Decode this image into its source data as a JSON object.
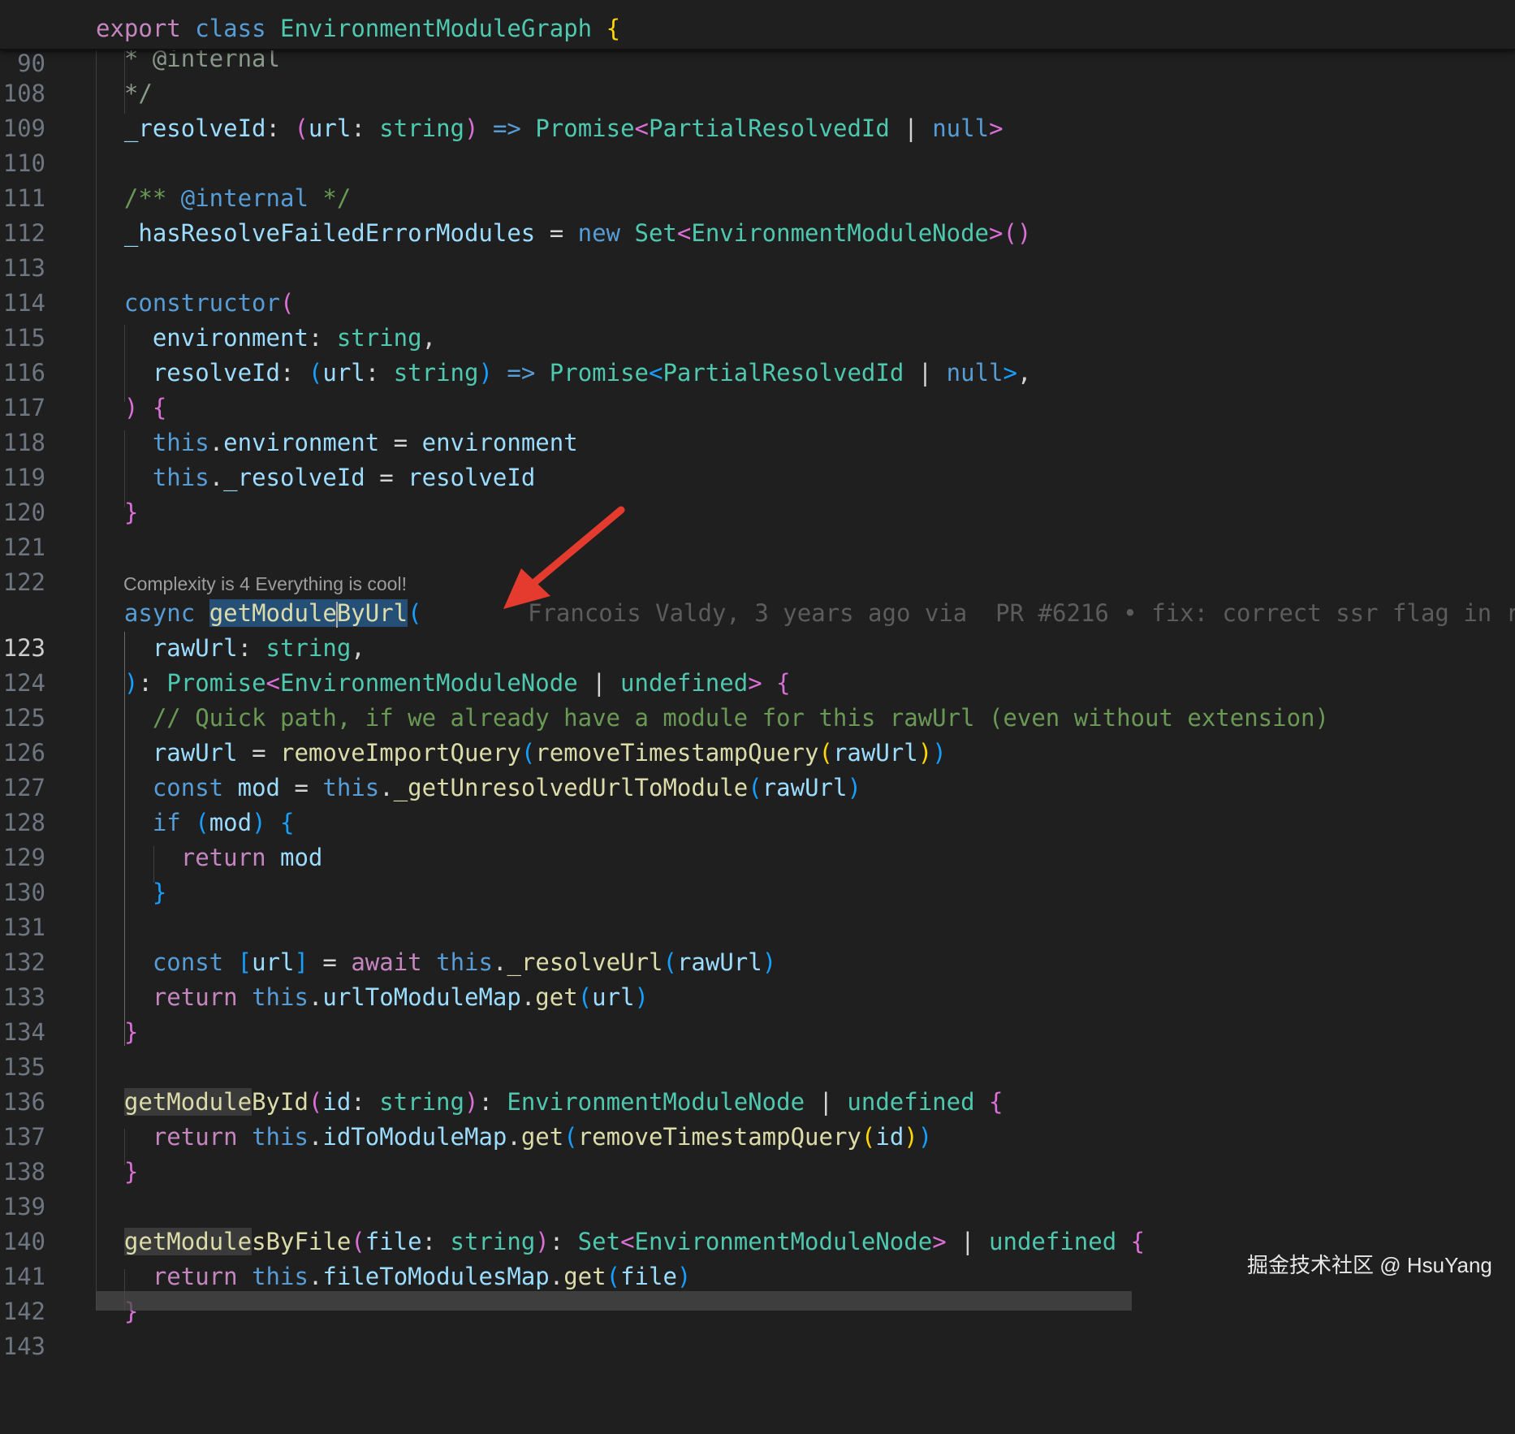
{
  "sticky": {
    "line_number": "90",
    "code": "export class EnvironmentModuleGraph {"
  },
  "code_lens": "Complexity is 4 Everything is cool!",
  "blame": "Francois Valdy, 3 years ago via  PR #6216 • fix: correct ssr flag in r",
  "watermark": "掘金技术社区 @ HsuYang",
  "current_line": "123",
  "colors": {
    "background": "#1f1f1f",
    "keyword": "#569cd6",
    "type": "#4ec9b0",
    "function": "#dcdcaa",
    "variable": "#9cdcfe",
    "comment": "#6a9955",
    "selection": "#264f78",
    "arrow": "#e53b2e"
  },
  "lines": [
    {
      "n": "108",
      "text": "  * @internal"
    },
    {
      "n": "109",
      "text": "  */"
    },
    {
      "n": "110",
      "text": "_resolveId: (url: string) => Promise<PartialResolvedId | null>"
    },
    {
      "n": "111",
      "text": ""
    },
    {
      "n": "112",
      "text": "/** @internal */"
    },
    {
      "n": "113",
      "text": "_hasResolveFailedErrorModules = new Set<EnvironmentModuleNode>()"
    },
    {
      "n": "114",
      "text": ""
    },
    {
      "n": "115",
      "text": "constructor("
    },
    {
      "n": "116",
      "text": "  environment: string,"
    },
    {
      "n": "117",
      "text": "  resolveId: (url: string) => Promise<PartialResolvedId | null>,"
    },
    {
      "n": "118",
      "text": ") {"
    },
    {
      "n": "119",
      "text": "  this.environment = environment"
    },
    {
      "n": "120",
      "text": "  this._resolveId = resolveId"
    },
    {
      "n": "121",
      "text": "}"
    },
    {
      "n": "122",
      "text": ""
    },
    {
      "n": "123",
      "text": "async getModuleByUrl("
    },
    {
      "n": "124",
      "text": "  rawUrl: string,"
    },
    {
      "n": "125",
      "text": "): Promise<EnvironmentModuleNode | undefined> {"
    },
    {
      "n": "126",
      "text": "  // Quick path, if we already have a module for this rawUrl (even without extension)"
    },
    {
      "n": "127",
      "text": "  rawUrl = removeImportQuery(removeTimestampQuery(rawUrl))"
    },
    {
      "n": "128",
      "text": "  const mod = this._getUnresolvedUrlToModule(rawUrl)"
    },
    {
      "n": "129",
      "text": "  if (mod) {"
    },
    {
      "n": "130",
      "text": "    return mod"
    },
    {
      "n": "131",
      "text": "  }"
    },
    {
      "n": "132",
      "text": ""
    },
    {
      "n": "133",
      "text": "  const [url] = await this._resolveUrl(rawUrl)"
    },
    {
      "n": "134",
      "text": "  return this.urlToModuleMap.get(url)"
    },
    {
      "n": "135",
      "text": "}"
    },
    {
      "n": "136",
      "text": ""
    },
    {
      "n": "137",
      "text": "getModuleById(id: string): EnvironmentModuleNode | undefined {"
    },
    {
      "n": "138",
      "text": "  return this.idToModuleMap.get(removeTimestampQuery(id))"
    },
    {
      "n": "139",
      "text": "}"
    },
    {
      "n": "140",
      "text": ""
    },
    {
      "n": "141",
      "text": "getModulesByFile(file: string): Set<EnvironmentModuleNode> | undefined {"
    },
    {
      "n": "142",
      "text": "  return this.fileToModulesMap.get(file)"
    },
    {
      "n": "143",
      "text": "}"
    }
  ]
}
